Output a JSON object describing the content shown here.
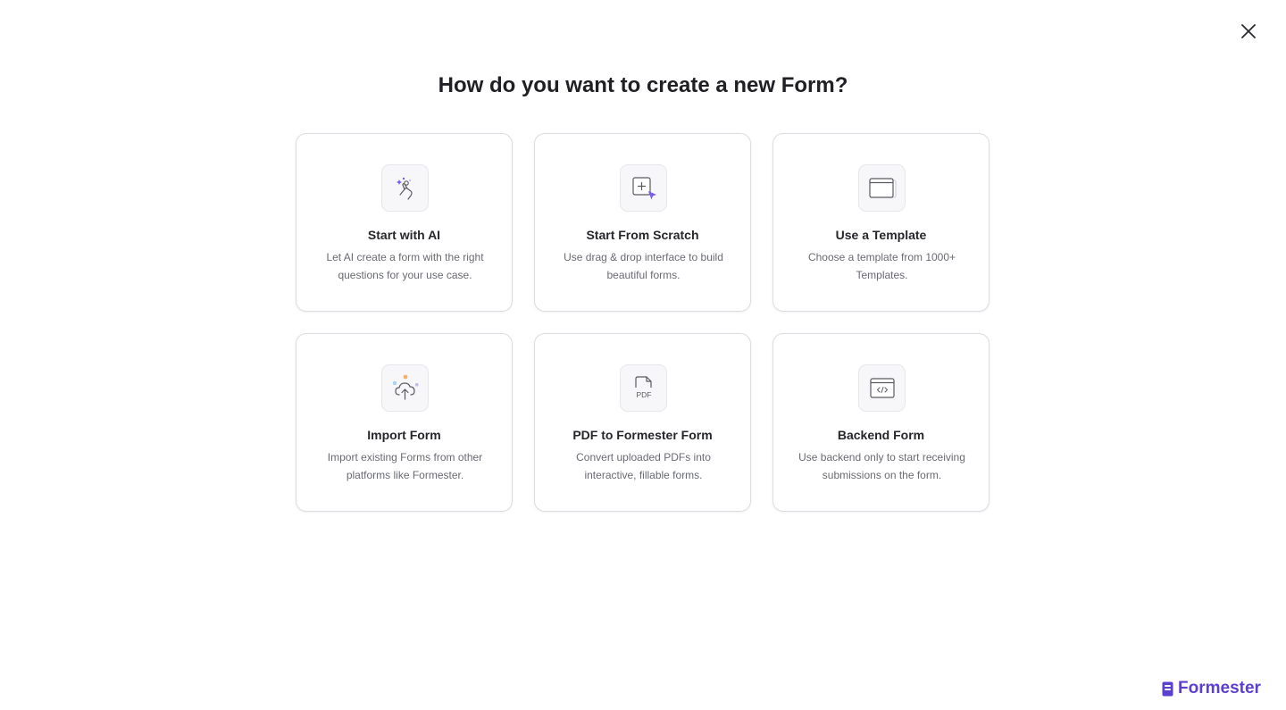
{
  "dialog": {
    "title": "How do you want to create a new Form?",
    "close_icon": "close-icon"
  },
  "options": [
    {
      "title": "Start with AI",
      "description": "Let AI create a form with the right questions for your use case.",
      "icon": "ai-hand-sparkle-icon"
    },
    {
      "title": "Start From Scratch",
      "description": "Use drag & drop interface to build beautiful forms.",
      "icon": "add-box-cursor-icon"
    },
    {
      "title": "Use a Template",
      "description": "Choose a template from 1000+ Templates.",
      "icon": "template-window-icon"
    },
    {
      "title": "Import Form",
      "description": "Import existing Forms from other platforms like Formester.",
      "icon": "cloud-upload-icon"
    },
    {
      "title": "PDF to Formester Form",
      "description": "Convert uploaded PDFs into interactive, fillable forms.",
      "icon": "pdf-file-icon",
      "icon_text": "PDF"
    },
    {
      "title": "Backend Form",
      "description": "Use backend only to start receiving submissions on the form.",
      "icon": "code-window-icon"
    }
  ],
  "brand": {
    "name": "Formester",
    "icon": "formester-logo-icon",
    "color": "#5b3fd1"
  },
  "colors": {
    "accent": "#7b5cf0",
    "text": "#1f1f24",
    "muted": "#6a6b72",
    "border": "#dcdde2"
  }
}
